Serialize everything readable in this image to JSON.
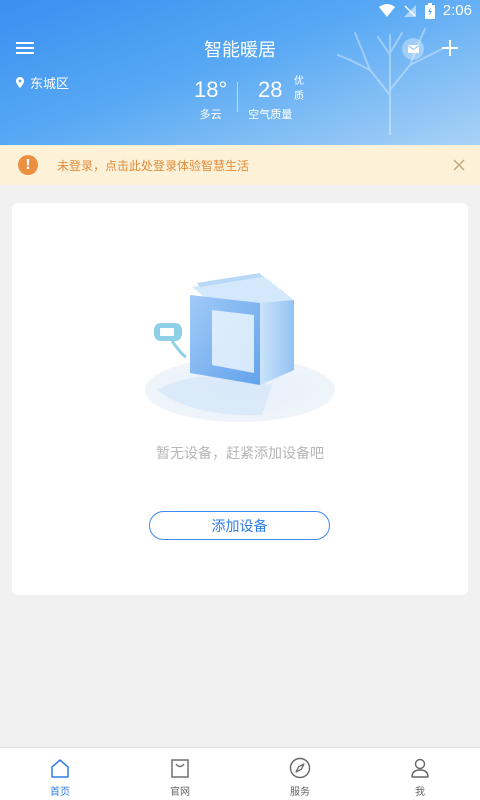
{
  "status_bar": {
    "time": "2:06"
  },
  "header": {
    "title": "智能暖居",
    "location": "东城区",
    "weather": {
      "temperature": "18°",
      "condition": "多云",
      "aqi_value": "28",
      "aqi_grade": "优质",
      "aqi_label": "空气质量"
    }
  },
  "banner": {
    "text": "未登录，点击此处登录体验智慧生活"
  },
  "card": {
    "empty_text": "暂无设备，赶紧添加设备吧",
    "add_button_label": "添加设备"
  },
  "bottom_nav": {
    "items": [
      {
        "label": "首页",
        "icon": "home-icon",
        "active": true
      },
      {
        "label": "官网",
        "icon": "shopping-bag-icon",
        "active": false
      },
      {
        "label": "服务",
        "icon": "compass-icon",
        "active": false
      },
      {
        "label": "我",
        "icon": "person-icon",
        "active": false
      }
    ]
  },
  "colors": {
    "header_gradient_start": "#3a8ff0",
    "header_gradient_end": "#a9d2f6",
    "accent": "#2f7ee6",
    "banner_bg": "#fdf2d8",
    "banner_text": "#e08b3b"
  }
}
